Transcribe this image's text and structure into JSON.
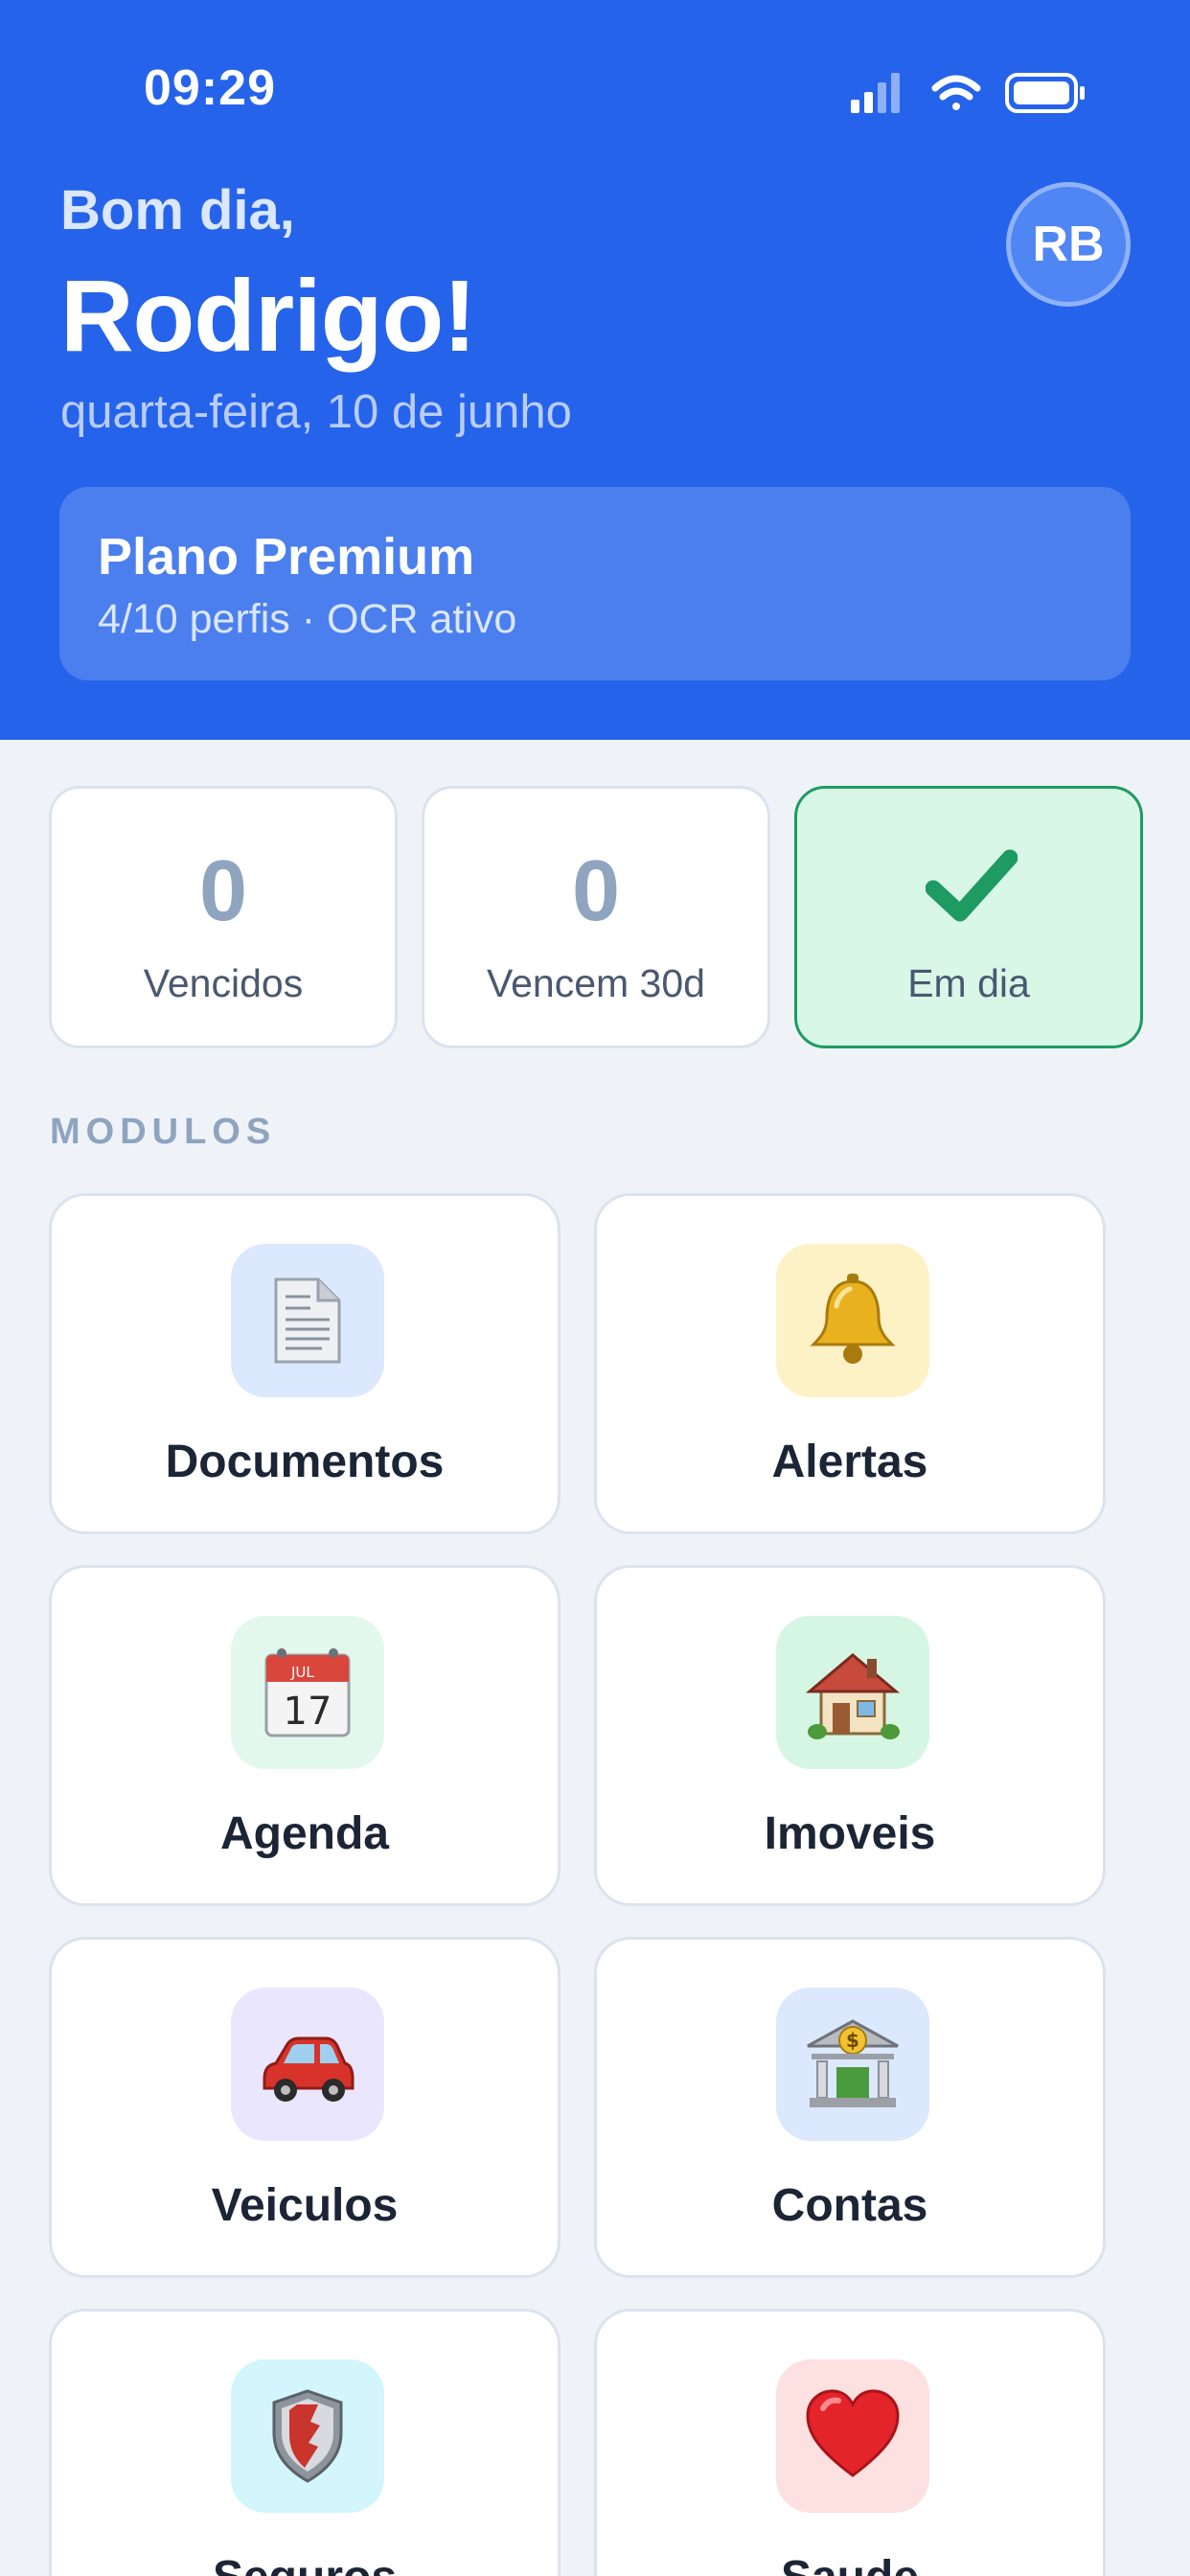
{
  "status_bar": {
    "time": "09:29"
  },
  "header": {
    "greeting": "Bom dia,",
    "name": "Rodrigo!",
    "date": "quarta-feira, 10 de junho",
    "avatar_initials": "RB"
  },
  "plan": {
    "title": "Plano Premium",
    "subtitle": "4/10 perfis · OCR ativo"
  },
  "stats": [
    {
      "value": "0",
      "label": "Vencidos"
    },
    {
      "value": "0",
      "label": "Vencem 30d"
    },
    {
      "icon": "check-icon",
      "label": "Em dia"
    }
  ],
  "section_title": "MODULOS",
  "modules": [
    {
      "label": "Documentos",
      "icon": "document-icon",
      "icon_bg": "#dbe8fd"
    },
    {
      "label": "Alertas",
      "icon": "bell-icon",
      "icon_bg": "#fdf1c6"
    },
    {
      "label": "Agenda",
      "icon": "calendar-icon",
      "icon_bg": "#e3f8ec"
    },
    {
      "label": "Imoveis",
      "icon": "house-icon",
      "icon_bg": "#d6f6e4"
    },
    {
      "label": "Veiculos",
      "icon": "car-icon",
      "icon_bg": "#e9e6fd"
    },
    {
      "label": "Contas",
      "icon": "bank-icon",
      "icon_bg": "#dbe8fd"
    },
    {
      "label": "Seguros",
      "icon": "shield-icon",
      "icon_bg": "#d2f6fb"
    },
    {
      "label": "Saude",
      "icon": "heart-icon",
      "icon_bg": "#fde0e0"
    }
  ],
  "colors": {
    "header_bg": "#2563eb",
    "page_bg": "#eff3f8",
    "ok_green": "#1e9b62"
  }
}
